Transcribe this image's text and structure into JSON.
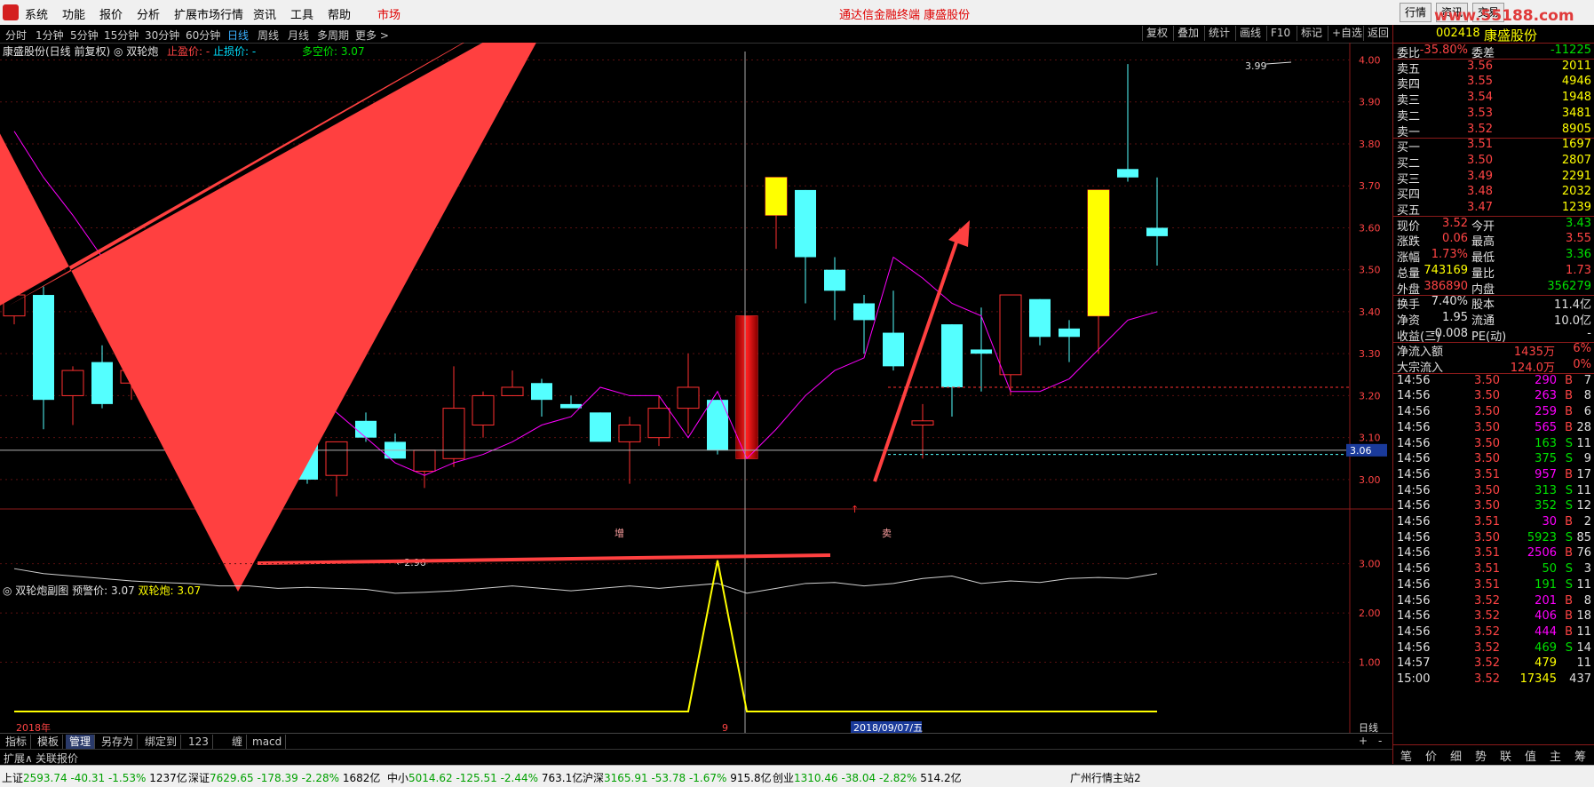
{
  "menu": {
    "items": [
      "系统",
      "功能",
      "报价",
      "分析",
      "扩展市场行情",
      "资讯",
      "工具",
      "帮助"
    ],
    "market": "市场",
    "center_title": "通达信金融终端  康盛股份",
    "right_buttons": [
      "行情",
      "资讯",
      "交易"
    ],
    "watermark": "www.55188.com"
  },
  "periods": {
    "items": [
      "分时",
      "1分钟",
      "5分钟",
      "15分钟",
      "30分钟",
      "60分钟",
      "日线",
      "周线",
      "月线",
      "多周期",
      "更多 >"
    ],
    "active_index": 6,
    "toolbar": [
      "复权",
      "叠加",
      "统计",
      "画线",
      "F10",
      "标记",
      "+自选",
      "返回"
    ]
  },
  "chart_info": {
    "title": "康盛股份(日线 前复权)",
    "indicator": "双轮炮",
    "stop_gain": "止盈价: -",
    "stop_loss": "止损价: -",
    "bull_bear": "多空价: 3.07"
  },
  "sub_info": {
    "title": "双轮炮副图",
    "warn": "预警价: 3.07",
    "gun": "双轮炮: 3.07"
  },
  "chart_data": {
    "type": "candlestick",
    "y_axis_ticks": [
      "4.00",
      "3.90",
      "3.80",
      "3.70",
      "3.60",
      "3.50",
      "3.40",
      "3.30",
      "3.20",
      "3.10",
      "3.00"
    ],
    "ylim": [
      2.93,
      4.02
    ],
    "candles": [
      {
        "o": 3.39,
        "h": 3.51,
        "l": 3.37,
        "c": 3.44
      },
      {
        "o": 3.44,
        "h": 3.46,
        "l": 3.12,
        "c": 3.19
      },
      {
        "o": 3.2,
        "h": 3.27,
        "l": 3.13,
        "c": 3.26
      },
      {
        "o": 3.28,
        "h": 3.32,
        "l": 3.17,
        "c": 3.18
      },
      {
        "o": 3.23,
        "h": 3.29,
        "l": 3.19,
        "c": 3.26
      },
      {
        "o": 3.22,
        "h": 3.26,
        "l": 3.19,
        "c": 3.26
      },
      {
        "o": 3.24,
        "h": 3.3,
        "l": 3.16,
        "c": 3.28
      },
      {
        "o": 3.33,
        "h": 3.33,
        "l": 3.25,
        "c": 3.27
      },
      {
        "o": 3.28,
        "h": 3.3,
        "l": 3.16,
        "c": 3.19
      },
      {
        "o": 3.15,
        "h": 3.2,
        "l": 3.08,
        "c": 3.13
      },
      {
        "o": 3.12,
        "h": 3.21,
        "l": 2.99,
        "c": 3.0
      },
      {
        "o": 3.01,
        "h": 3.09,
        "l": 2.96,
        "c": 3.09
      },
      {
        "o": 3.14,
        "h": 3.16,
        "l": 3.09,
        "c": 3.1
      },
      {
        "o": 3.09,
        "h": 3.11,
        "l": 3.05,
        "c": 3.05
      },
      {
        "o": 3.02,
        "h": 3.07,
        "l": 2.98,
        "c": 3.07
      },
      {
        "o": 3.05,
        "h": 3.27,
        "l": 3.03,
        "c": 3.17
      },
      {
        "o": 3.13,
        "h": 3.21,
        "l": 3.1,
        "c": 3.2
      },
      {
        "o": 3.2,
        "h": 3.26,
        "l": 3.2,
        "c": 3.22
      },
      {
        "o": 3.23,
        "h": 3.24,
        "l": 3.15,
        "c": 3.19
      },
      {
        "o": 3.18,
        "h": 3.2,
        "l": 3.17,
        "c": 3.17
      },
      {
        "o": 3.16,
        "h": 3.16,
        "l": 3.09,
        "c": 3.09
      },
      {
        "o": 3.09,
        "h": 3.15,
        "l": 2.99,
        "c": 3.13
      },
      {
        "o": 3.1,
        "h": 3.2,
        "l": 3.08,
        "c": 3.17
      },
      {
        "o": 3.17,
        "h": 3.3,
        "l": 3.11,
        "c": 3.22
      },
      {
        "o": 3.19,
        "h": 3.19,
        "l": 3.06,
        "c": 3.07
      },
      {
        "o": 3.05,
        "h": 3.39,
        "l": 3.05,
        "c": 3.39
      },
      {
        "o": 3.63,
        "h": 3.72,
        "l": 3.55,
        "c": 3.72
      },
      {
        "o": 3.69,
        "h": 3.69,
        "l": 3.42,
        "c": 3.53
      },
      {
        "o": 3.5,
        "h": 3.53,
        "l": 3.38,
        "c": 3.45
      },
      {
        "o": 3.42,
        "h": 3.44,
        "l": 3.3,
        "c": 3.38
      },
      {
        "o": 3.35,
        "h": 3.45,
        "l": 3.26,
        "c": 3.27
      },
      {
        "o": 3.13,
        "h": 3.18,
        "l": 3.05,
        "c": 3.14
      },
      {
        "o": 3.37,
        "h": 3.37,
        "l": 3.15,
        "c": 3.22
      },
      {
        "o": 3.31,
        "h": 3.41,
        "l": 3.21,
        "c": 3.3
      },
      {
        "o": 3.25,
        "h": 3.44,
        "l": 3.2,
        "c": 3.44
      },
      {
        "o": 3.43,
        "h": 3.43,
        "l": 3.32,
        "c": 3.34
      },
      {
        "o": 3.36,
        "h": 3.38,
        "l": 3.28,
        "c": 3.34
      },
      {
        "o": 3.39,
        "h": 3.69,
        "l": 3.3,
        "c": 3.69
      },
      {
        "o": 3.74,
        "h": 3.99,
        "l": 3.71,
        "c": 3.72
      },
      {
        "o": 3.6,
        "h": 3.72,
        "l": 3.51,
        "c": 3.58
      }
    ],
    "ma_line": [
      3.83,
      3.72,
      3.63,
      3.53,
      3.44,
      3.35,
      3.3,
      3.27,
      3.26,
      3.25,
      3.22,
      3.16,
      3.1,
      3.04,
      3.01,
      3.04,
      3.06,
      3.09,
      3.13,
      3.15,
      3.22,
      3.2,
      3.2,
      3.1,
      3.21,
      3.05,
      3.12,
      3.2,
      3.26,
      3.29,
      3.53,
      3.48,
      3.42,
      3.39,
      3.21,
      3.21,
      3.24,
      3.31,
      3.38,
      3.4
    ],
    "bull_bear_line": 3.07,
    "price_label": "3.06",
    "high_label": "3.99",
    "low_label": "2.96",
    "marker_zeng": "增",
    "marker_mai": "卖",
    "sub_ticks": [
      "3.00",
      "2.00",
      "1.00"
    ],
    "sub_white_line": [
      2.9,
      2.8,
      2.75,
      2.7,
      2.65,
      2.62,
      2.6,
      2.55,
      2.55,
      2.5,
      2.52,
      2.5,
      2.48,
      2.4,
      2.42,
      2.45,
      2.5,
      2.55,
      2.5,
      2.45,
      2.5,
      2.55,
      2.5,
      2.55,
      2.6,
      2.4,
      2.5,
      2.6,
      2.62,
      2.55,
      2.6,
      2.7,
      2.75,
      2.6,
      2.65,
      2.62,
      2.7,
      2.72,
      2.7,
      2.8
    ],
    "sub_yellow_line": [
      0,
      0,
      0,
      0,
      0,
      0,
      0,
      0,
      0,
      0,
      0,
      0,
      0,
      0,
      0,
      0,
      0,
      0,
      0,
      0,
      0,
      0,
      0,
      0,
      3.07,
      0,
      0,
      0,
      0,
      0,
      0,
      0,
      0,
      0,
      0,
      0,
      0,
      0,
      0,
      0
    ],
    "x_labels": [
      "2018年",
      "9",
      "2018/09/07/五"
    ],
    "period_label": "日线"
  },
  "quote": {
    "code": "002418",
    "name": "康盛股份",
    "weibi_label": "委比",
    "weibi": "-35.80%",
    "weicha_label": "委差",
    "weicha": "-11225",
    "asks": [
      {
        "label": "卖五",
        "price": "3.56",
        "vol": "2011"
      },
      {
        "label": "卖四",
        "price": "3.55",
        "vol": "4946"
      },
      {
        "label": "卖三",
        "price": "3.54",
        "vol": "1948"
      },
      {
        "label": "卖二",
        "price": "3.53",
        "vol": "3481"
      },
      {
        "label": "卖一",
        "price": "3.52",
        "vol": "8905"
      }
    ],
    "bids": [
      {
        "label": "买一",
        "price": "3.51",
        "vol": "1697"
      },
      {
        "label": "买二",
        "price": "3.50",
        "vol": "2807"
      },
      {
        "label": "买三",
        "price": "3.49",
        "vol": "2291"
      },
      {
        "label": "买四",
        "price": "3.48",
        "vol": "2032"
      },
      {
        "label": "买五",
        "price": "3.47",
        "vol": "1239"
      }
    ],
    "stats": [
      {
        "l1": "现价",
        "v1": "3.52",
        "c1": "red",
        "l2": "今开",
        "v2": "3.43",
        "c2": "grn"
      },
      {
        "l1": "涨跌",
        "v1": "0.06",
        "c1": "red",
        "l2": "最高",
        "v2": "3.55",
        "c2": "red"
      },
      {
        "l1": "涨幅",
        "v1": "1.73%",
        "c1": "red",
        "l2": "最低",
        "v2": "3.36",
        "c2": "grn"
      },
      {
        "l1": "总量",
        "v1": "743169",
        "c1": "yel",
        "l2": "量比",
        "v2": "1.73",
        "c2": "red"
      },
      {
        "l1": "外盘",
        "v1": "386890",
        "c1": "red",
        "l2": "内盘",
        "v2": "356279",
        "c2": "grn"
      }
    ],
    "stats2": [
      {
        "l1": "换手",
        "v1": "7.40%",
        "l2": "股本",
        "v2": "11.4亿"
      },
      {
        "l1": "净资",
        "v1": "1.95",
        "l2": "流通",
        "v2": "10.0亿"
      },
      {
        "l1": "收益(三)",
        "v1": "-0.008",
        "l2": "PE(动)",
        "v2": "-"
      }
    ],
    "flow": [
      {
        "label": "净流入额",
        "v": "1435万",
        "p": "6%"
      },
      {
        "label": "大宗流入",
        "v": "124.0万",
        "p": "0%"
      }
    ],
    "ticks": [
      {
        "t": "14:56",
        "p": "3.50",
        "v": "290",
        "bs": "B",
        "n": "7"
      },
      {
        "t": "14:56",
        "p": "3.50",
        "v": "263",
        "bs": "B",
        "n": "8"
      },
      {
        "t": "14:56",
        "p": "3.50",
        "v": "259",
        "bs": "B",
        "n": "6"
      },
      {
        "t": "14:56",
        "p": "3.50",
        "v": "565",
        "bs": "B",
        "n": "28"
      },
      {
        "t": "14:56",
        "p": "3.50",
        "v": "163",
        "bs": "S",
        "n": "11"
      },
      {
        "t": "14:56",
        "p": "3.50",
        "v": "375",
        "bs": "S",
        "n": "9"
      },
      {
        "t": "14:56",
        "p": "3.51",
        "v": "957",
        "bs": "B",
        "n": "17"
      },
      {
        "t": "14:56",
        "p": "3.50",
        "v": "313",
        "bs": "S",
        "n": "11"
      },
      {
        "t": "14:56",
        "p": "3.50",
        "v": "352",
        "bs": "S",
        "n": "12"
      },
      {
        "t": "14:56",
        "p": "3.51",
        "v": "30",
        "bs": "B",
        "n": "2"
      },
      {
        "t": "14:56",
        "p": "3.50",
        "v": "5923",
        "bs": "S",
        "n": "85"
      },
      {
        "t": "14:56",
        "p": "3.51",
        "v": "2506",
        "bs": "B",
        "n": "76"
      },
      {
        "t": "14:56",
        "p": "3.51",
        "v": "50",
        "bs": "S",
        "n": "3"
      },
      {
        "t": "14:56",
        "p": "3.51",
        "v": "191",
        "bs": "S",
        "n": "11"
      },
      {
        "t": "14:56",
        "p": "3.52",
        "v": "201",
        "bs": "B",
        "n": "8"
      },
      {
        "t": "14:56",
        "p": "3.52",
        "v": "406",
        "bs": "B",
        "n": "18"
      },
      {
        "t": "14:56",
        "p": "3.52",
        "v": "444",
        "bs": "B",
        "n": "11"
      },
      {
        "t": "14:56",
        "p": "3.52",
        "v": "469",
        "bs": "S",
        "n": "14"
      },
      {
        "t": "14:57",
        "p": "3.52",
        "v": "479",
        "bs": "",
        "n": "11"
      },
      {
        "t": "15:00",
        "p": "3.52",
        "v": "17345",
        "bs": "",
        "n": "437"
      }
    ],
    "tabs": [
      "笔",
      "价",
      "细",
      "势",
      "联",
      "值",
      "主",
      "筹"
    ]
  },
  "bottom_tabs": [
    "指标",
    "模板",
    "管理",
    "另存为",
    "绑定到",
    "123",
    "缠",
    "macd"
  ],
  "bottom_sel": 2,
  "ext_bar": [
    "扩展∧",
    "关联报价"
  ],
  "status": [
    {
      "label": "上证",
      "v": "2593.74",
      "d": "-40.31",
      "p": "-1.53%",
      "a": "1237亿"
    },
    {
      "label": "深证",
      "v": "7629.65",
      "d": "-178.39",
      "p": "-2.28%",
      "a": "1682亿"
    },
    {
      "label": "中小",
      "v": "5014.62",
      "d": "-125.51",
      "p": "-2.44%",
      "a": "763.1亿"
    },
    {
      "label": "沪深",
      "v": "3165.91",
      "d": "-53.78",
      "p": "-1.67%",
      "a": "915.8亿"
    },
    {
      "label": "创业",
      "v": "1310.46",
      "d": "-38.04",
      "p": "-2.82%",
      "a": "514.2亿"
    }
  ],
  "status_server": "广州行情主站2"
}
